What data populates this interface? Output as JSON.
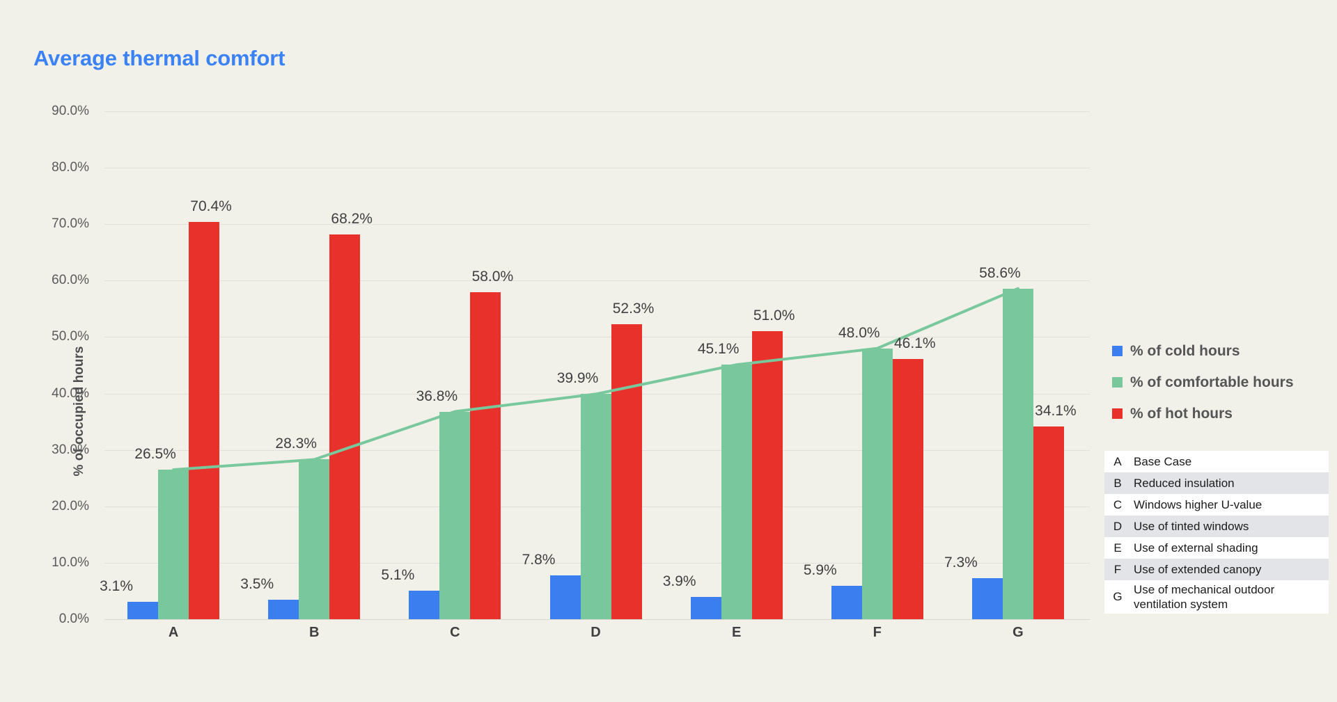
{
  "title": "Average thermal comfort",
  "colors": {
    "background": "#f1f1e9",
    "title": "#3b82f6",
    "cold": "#3b7ef0",
    "comfortable": "#79c89d",
    "hot": "#e8312a",
    "gridline": "#e0e0da",
    "text": "#4d4d4d"
  },
  "legend": {
    "items": [
      {
        "label": "% of cold hours",
        "color": "#3b7ef0",
        "icon": "square-swatch-icon"
      },
      {
        "label": "% of comfortable hours",
        "color": "#79c89d",
        "icon": "square-swatch-icon"
      },
      {
        "label": "% of hot hours",
        "color": "#e8312a",
        "icon": "square-swatch-icon"
      }
    ]
  },
  "scenario_table": {
    "rows": [
      {
        "key": "A",
        "description": "Base Case"
      },
      {
        "key": "B",
        "description": "Reduced insulation"
      },
      {
        "key": "C",
        "description": "Windows higher U-value"
      },
      {
        "key": "D",
        "description": "Use of tinted windows"
      },
      {
        "key": "E",
        "description": "Use of external shading"
      },
      {
        "key": "F",
        "description": "Use of extended canopy"
      },
      {
        "key": "G",
        "description": "Use of mechanical outdoor ventilation system"
      }
    ]
  },
  "chart_data": {
    "type": "bar",
    "title": "Average thermal comfort",
    "xlabel": "",
    "ylabel": "% of occupied hours",
    "ylim": [
      0,
      90
    ],
    "ytick_labels": [
      "0.0%",
      "10.0%",
      "20.0%",
      "30.0%",
      "40.0%",
      "50.0%",
      "60.0%",
      "70.0%",
      "80.0%",
      "90.0%"
    ],
    "ytick_values": [
      0,
      10,
      20,
      30,
      40,
      50,
      60,
      70,
      80,
      90
    ],
    "grid": true,
    "legend_position": "right",
    "categories": [
      "A",
      "B",
      "C",
      "D",
      "E",
      "F",
      "G"
    ],
    "series": [
      {
        "name": "% of cold hours",
        "color": "#3b7ef0",
        "values": [
          3.1,
          3.5,
          5.1,
          7.8,
          3.9,
          5.9,
          7.3
        ],
        "labels": [
          "3.1%",
          "3.5%",
          "5.1%",
          "7.8%",
          "3.9%",
          "5.9%",
          "7.3%"
        ]
      },
      {
        "name": "% of comfortable hours",
        "color": "#79c89d",
        "values": [
          26.5,
          28.3,
          36.8,
          39.9,
          45.1,
          48.0,
          58.6
        ],
        "labels": [
          "26.5%",
          "28.3%",
          "36.8%",
          "39.9%",
          "45.1%",
          "48.0%",
          "58.6%"
        ]
      },
      {
        "name": "% of hot hours",
        "color": "#e8312a",
        "values": [
          70.4,
          68.2,
          58.0,
          52.3,
          51.0,
          46.1,
          34.1
        ],
        "labels": [
          "70.4%",
          "68.2%",
          "58.0%",
          "52.3%",
          "51.0%",
          "46.1%",
          "34.1%"
        ]
      }
    ],
    "overlay_line": {
      "name": "% of comfortable hours trend",
      "color": "#79c89d",
      "values": [
        26.5,
        28.3,
        36.8,
        39.9,
        45.1,
        48.0,
        58.6
      ]
    }
  }
}
